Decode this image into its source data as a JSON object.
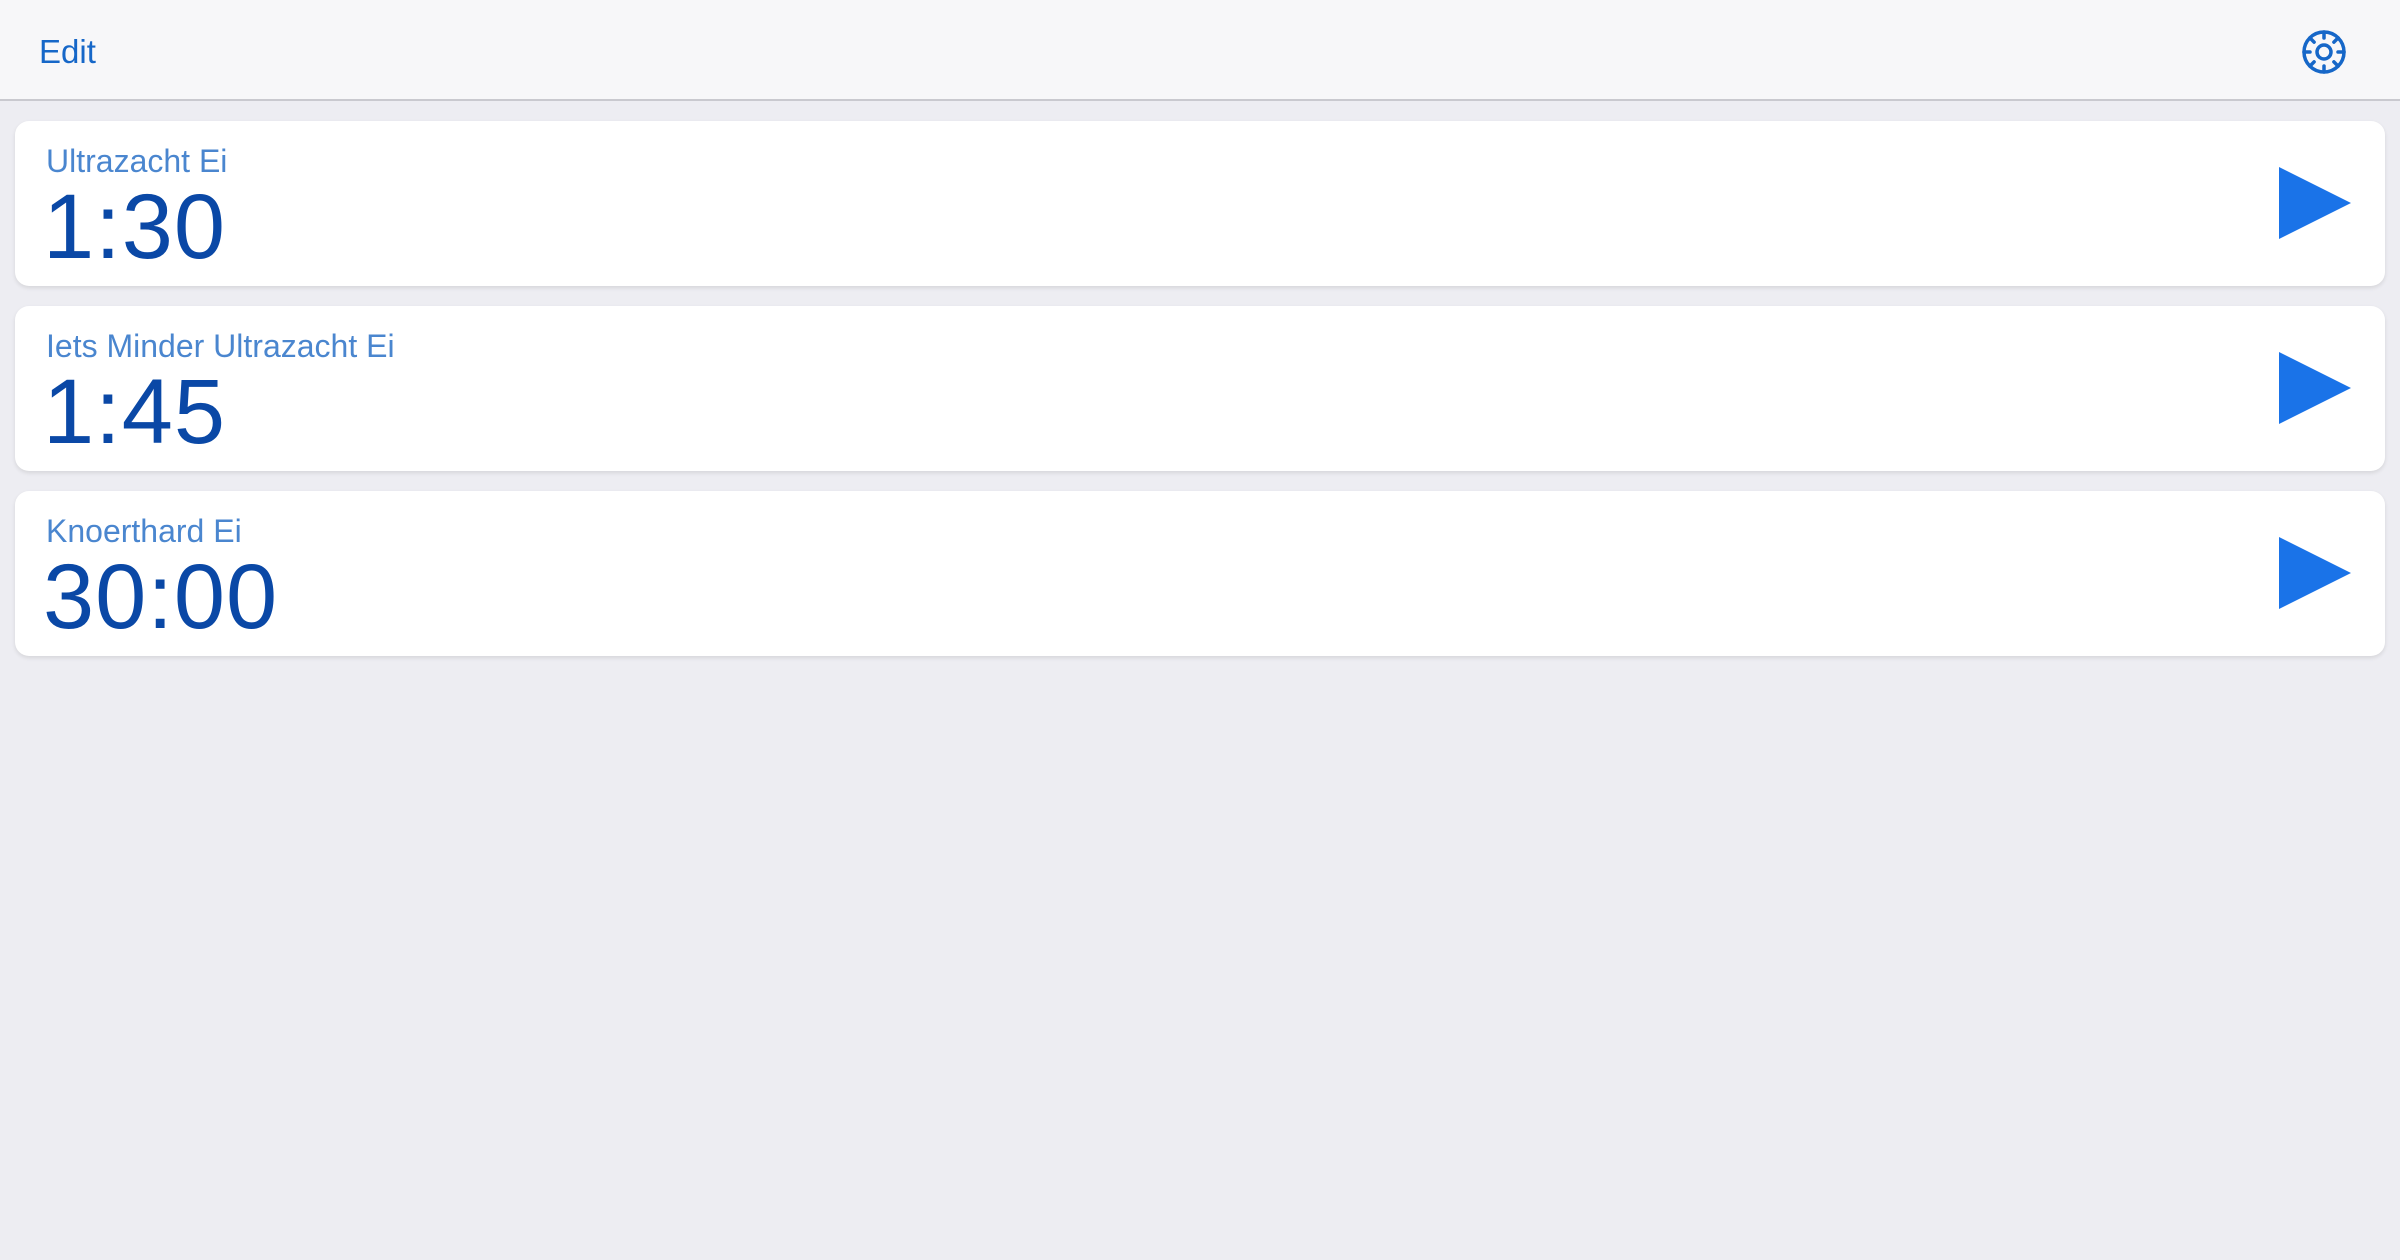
{
  "navbar": {
    "edit_label": "Edit",
    "settings_icon": "gear-icon"
  },
  "colors": {
    "accent": "#1a73e8",
    "label": "#4a86cf",
    "duration": "#0a48a6",
    "background": "#ededf2"
  },
  "timers": [
    {
      "name": "Ultrazacht Ei",
      "duration": "1:30",
      "action_icon": "play-icon"
    },
    {
      "name": "Iets Minder Ultrazacht Ei",
      "duration": "1:45",
      "action_icon": "play-icon"
    },
    {
      "name": "Knoerthard Ei",
      "duration": "30:00",
      "action_icon": "play-icon"
    }
  ]
}
